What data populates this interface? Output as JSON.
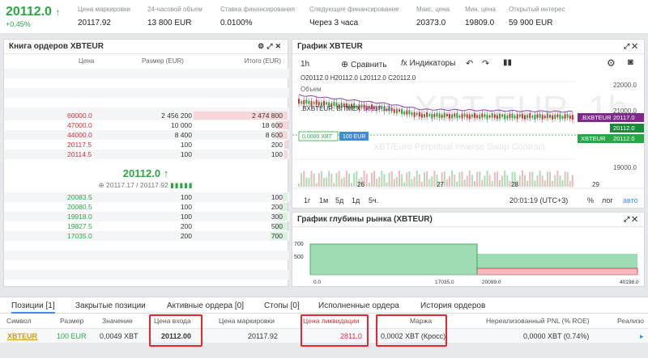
{
  "top": {
    "price": "20112.0",
    "arrow": "↑",
    "change": "+0.45%",
    "stats": [
      {
        "label": "Цена маркировки",
        "value": "20117.92"
      },
      {
        "label": "24-часовой объем",
        "value": "13 800 EUR"
      },
      {
        "label": "Ставка финансирования",
        "value": "0.0100%"
      },
      {
        "label": "Следующее финансирование",
        "value": "Через 3 часа"
      },
      {
        "label": "Макс. цена",
        "value": "20373.0"
      },
      {
        "label": "Мин. цена",
        "value": "19809.0"
      },
      {
        "label": "Открытый интерес",
        "value": "59 900 EUR"
      }
    ]
  },
  "orderbook": {
    "title": "Книга ордеров XBTEUR",
    "col_price": "Цена",
    "col_size": "Размер (EUR)",
    "col_total": "Итого (EUR)",
    "asks": [
      {
        "price": "60000.0",
        "size": "2 456 200",
        "total": "2 474 800",
        "depth": 1.0
      },
      {
        "price": "47000.0",
        "size": "10 000",
        "total": "18 600",
        "depth": 0.12
      },
      {
        "price": "44000.0",
        "size": "8 400",
        "total": "8 600",
        "depth": 0.11
      },
      {
        "price": "20117.5",
        "size": "100",
        "total": "200",
        "depth": 0.03
      },
      {
        "price": "20114.5",
        "size": "100",
        "total": "100",
        "depth": 0.02
      }
    ],
    "mid_price": "20112.0",
    "mid_arrow": "↑",
    "mark_line": "20117.17 / 20117.92",
    "bids": [
      {
        "price": "20083.5",
        "size": "100",
        "total": "100",
        "depth": 0.05
      },
      {
        "price": "20080.5",
        "size": "100",
        "total": "200",
        "depth": 0.08
      },
      {
        "price": "19918.0",
        "size": "100",
        "total": "300",
        "depth": 0.1
      },
      {
        "price": "19827.5",
        "size": "200",
        "total": "500",
        "depth": 0.14
      },
      {
        "price": "17035.0",
        "size": "200",
        "total": "700",
        "depth": 0.18
      }
    ]
  },
  "chart": {
    "title": "График XBTEUR",
    "interval": "1h",
    "compare": "Сравнить",
    "indicators": "Индикаторы",
    "ohlc": {
      "o": "20112.0",
      "h": "20112.0",
      "l": "20112.0",
      "c": "20112.0"
    },
    "volume_label": "Объем",
    "index_label": ".BXBTEUR, BITMEX",
    "index_value": "20117.17",
    "volume_value": "0,0000 XBT",
    "volume_eur": "100 EUR",
    "watermark": "XBT-EUR, 1h",
    "subtitle": "XBT/Euro Perpetual Inverse Swap Contract",
    "price_ticks": [
      "22000.0",
      "21000.0",
      "20000.0",
      "19000.0"
    ],
    "tag_bxbteur": {
      "label": ".BXBTEUR",
      "value": "20117.0"
    },
    "tag_last": "20112.0",
    "tag_xbteur": {
      "label": "XBTEUR",
      "value": "20112.0"
    },
    "date_ticks": [
      "26",
      "27",
      "28",
      "29"
    ],
    "ranges": [
      "1г",
      "1м",
      "5д",
      "1д",
      "5ч."
    ],
    "clock": "20:01:19 (UTC+3)",
    "pct": "%",
    "log": "лог",
    "auto": "авто"
  },
  "depth": {
    "title": "График глубины рынка (XBTEUR)",
    "y_ticks": [
      "700",
      "500"
    ],
    "x_ticks": [
      "0.0",
      "17035.0",
      "20099.0",
      "40198.0"
    ]
  },
  "tabs": [
    "Позиции [1]",
    "Закрытые позиции",
    "Активные ордера [0]",
    "Стопы [0]",
    "Исполненные ордера",
    "История ордеров"
  ],
  "positions": {
    "headers": {
      "symbol": "Символ",
      "size": "Размер",
      "value": "Значение",
      "entry": "Цена входа",
      "mark": "Цена маркировки",
      "liq": "Цена ликвидации",
      "margin": "Маржа",
      "pnl": "Нереализованный PNL (% ROE)",
      "realized": "Реализо"
    },
    "row": {
      "symbol": "XBTEUR",
      "size": "100 EUR",
      "value": "0,0049 XBT",
      "entry": "20112.00",
      "mark": "20117.92",
      "liq": "2811.0",
      "margin": "0,0002 XBT (Кросс)",
      "pnl": "0,0000 XBT (0.74%)"
    }
  },
  "colors": {
    "green": "#2aa745",
    "red": "#d0313d",
    "accent": "#3c8dde",
    "highlight": "#e8262f"
  }
}
